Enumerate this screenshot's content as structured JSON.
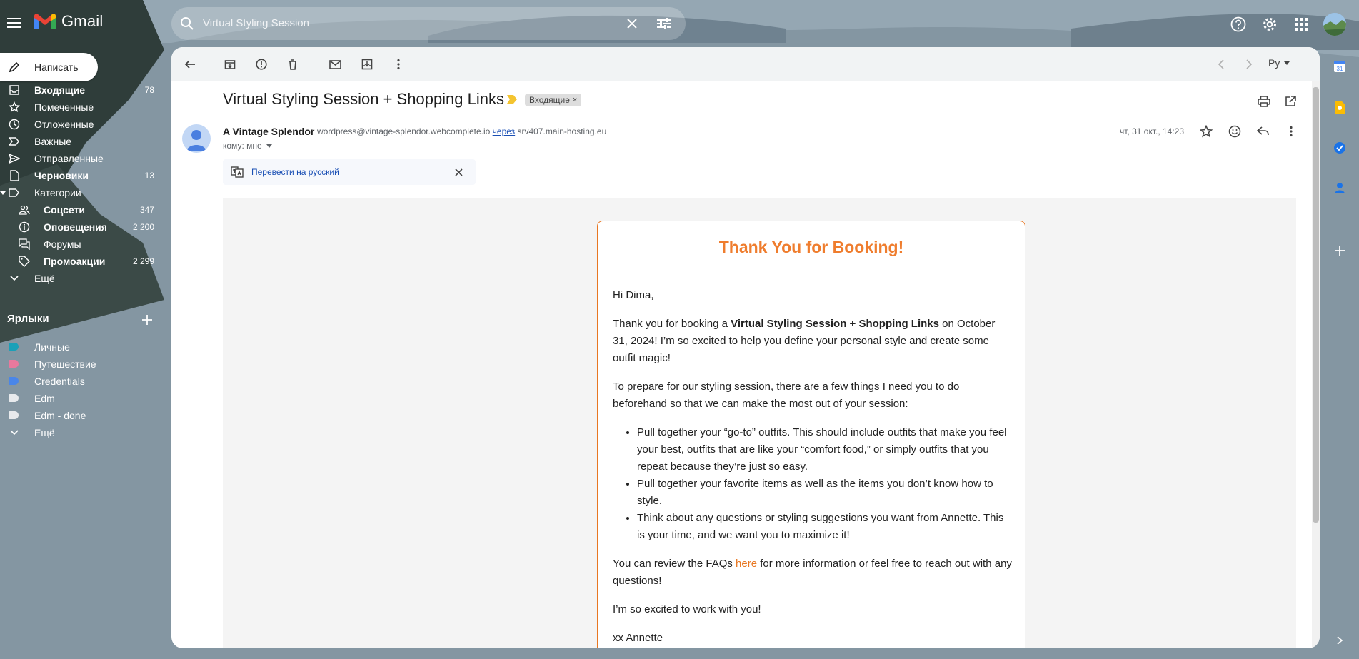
{
  "app": {
    "name": "Gmail"
  },
  "search": {
    "query": "Virtual Styling Session"
  },
  "sidebar": {
    "compose_label": "Написать",
    "items": [
      {
        "label": "Входящие",
        "count": "78",
        "bold": true,
        "icon": "inbox-icon"
      },
      {
        "label": "Помеченные",
        "count": "",
        "bold": false,
        "icon": "star-icon"
      },
      {
        "label": "Отложенные",
        "count": "",
        "bold": false,
        "icon": "clock-icon"
      },
      {
        "label": "Важные",
        "count": "",
        "bold": false,
        "icon": "important-icon"
      },
      {
        "label": "Отправленные",
        "count": "",
        "bold": false,
        "icon": "send-icon"
      },
      {
        "label": "Черновики",
        "count": "13",
        "bold": true,
        "icon": "draft-icon"
      },
      {
        "label": "Категории",
        "count": "",
        "bold": false,
        "icon": "label-icon"
      },
      {
        "label": "Соцсети",
        "count": "347",
        "bold": true,
        "icon": "people-icon"
      },
      {
        "label": "Оповещения",
        "count": "2 200",
        "bold": true,
        "icon": "info-icon"
      },
      {
        "label": "Форумы",
        "count": "",
        "bold": false,
        "icon": "forum-icon"
      },
      {
        "label": "Промоакции",
        "count": "2 299",
        "bold": true,
        "icon": "tag-icon"
      },
      {
        "label": "Ещё",
        "count": "",
        "bold": false,
        "icon": "chevron-down-icon"
      }
    ],
    "labels_header": "Ярлыки",
    "labels": [
      {
        "label": "Личные",
        "color": "#1aa0b8"
      },
      {
        "label": "Путешествие",
        "color": "#e8799d"
      },
      {
        "label": "Credentials",
        "color": "#4a86e8"
      },
      {
        "label": "Edm",
        "color": "#e8eaed"
      },
      {
        "label": "Edm - done",
        "color": "#e8eaed"
      },
      {
        "label": "Ещё",
        "color": ""
      }
    ]
  },
  "toolbar": {
    "lang": "Ру"
  },
  "message": {
    "subject": "Virtual Styling Session + Shopping Links",
    "inbox_chip": "Входящие",
    "sender_name": "A Vintage Splendor",
    "sender_email": "wordpress@vintage-splendor.webcomplete.io",
    "via_label": "через",
    "via_host": "srv407.main-hosting.eu",
    "to_line": "кому: мне",
    "date": "чт, 31 окт., 14:23",
    "translate_label": "Перевести на русский"
  },
  "email": {
    "title": "Thank You for Booking!",
    "greeting": "Hi Dima,",
    "p1_start": "Thank you for booking a ",
    "p1_bold": "Virtual Styling Session + Shopping Links",
    "p1_end": " on October 31, 2024! I’m so excited to help you define your personal style and create some outfit magic!",
    "p2": "To prepare for our styling session, there are a few things I need you to do beforehand so that we can make the most out of your session:",
    "bullets": [
      "Pull together your “go-to” outfits. This should include outfits that make you feel your best, outfits that are like your “comfort food,” or simply outfits that you repeat because they’re just so easy.",
      "Pull together your favorite items as well as the items you don’t know how to style.",
      "Think about any questions or styling suggestions you want from Annette. This is your time, and we want you to maximize it!"
    ],
    "p3_start": "You can review the FAQs ",
    "p3_link": "here",
    "p3_end": " for more information or feel free to reach out with any questions!",
    "p4": "I’m so excited to work with you!",
    "signoff": "xx Annette"
  },
  "colors": {
    "accent_orange": "#ef7d2e",
    "link_blue": "#1a4fb4",
    "gmail_red": "#ea4335"
  }
}
